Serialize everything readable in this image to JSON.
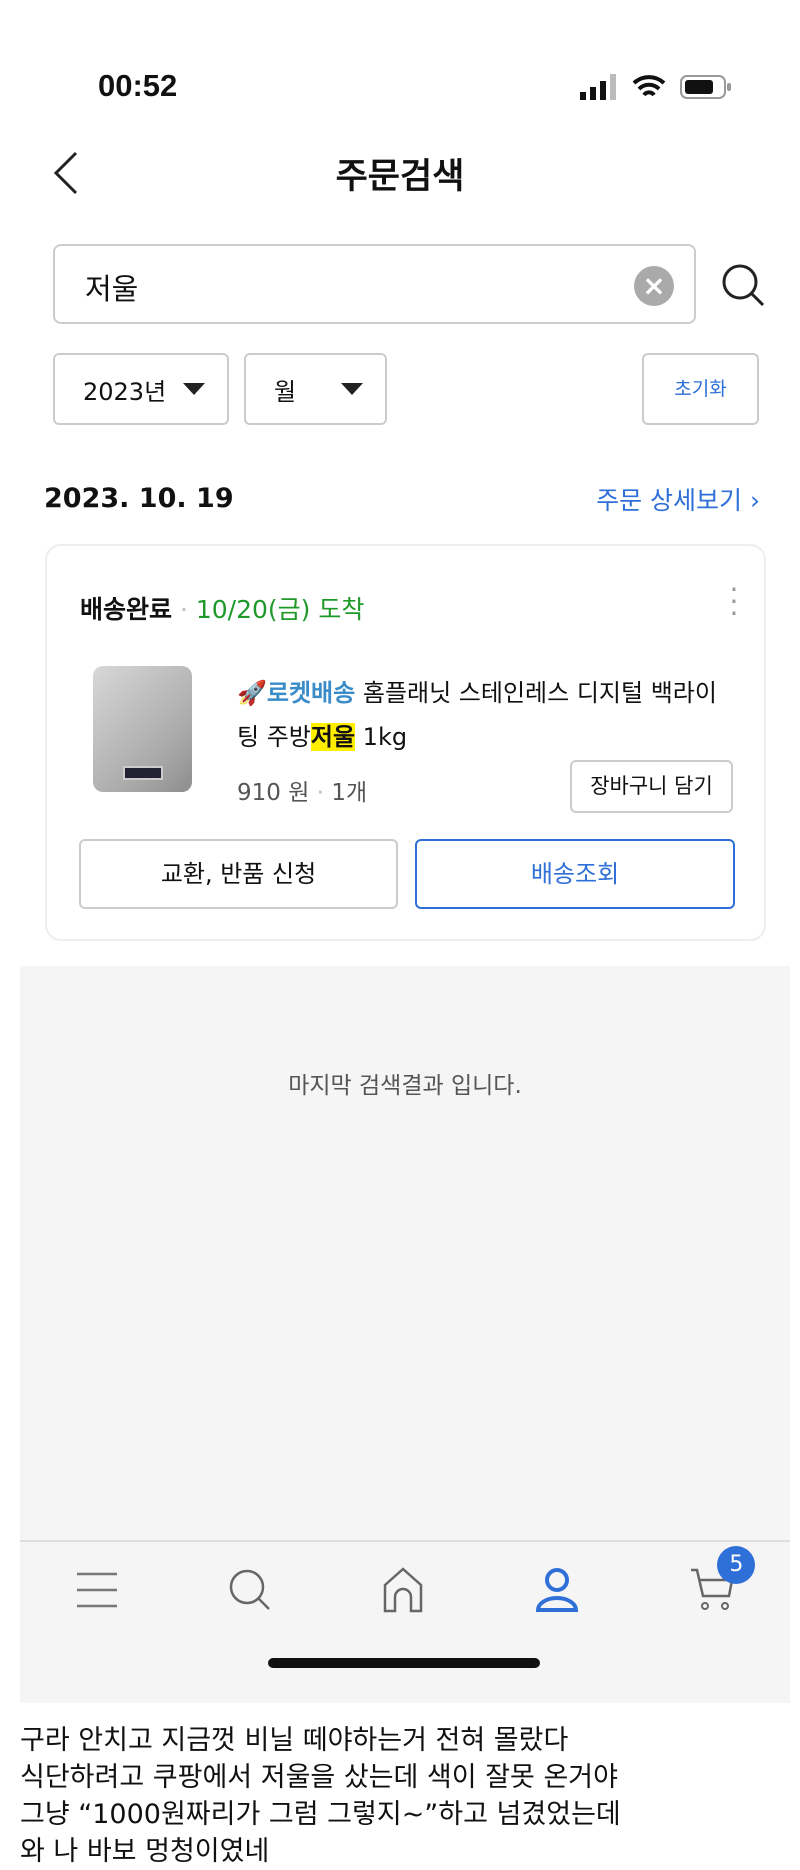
{
  "status": {
    "time": "00:52"
  },
  "header": {
    "title": "주문검색"
  },
  "search": {
    "value": "저울"
  },
  "filters": {
    "year": "2023년",
    "month": "월",
    "reset": "초기화"
  },
  "order": {
    "date": "2023. 10. 19",
    "detail_link": "주문 상세보기",
    "status": "배송완료",
    "arrival": "10/20(금) 도착",
    "rocket": "로켓배송",
    "title_pre": "홈플래닛 스테인레스 디지털 백라이팅 주방",
    "title_hl": "저울",
    "title_post": " 1kg",
    "price": "910 원",
    "qty": "1개",
    "cart_button": "장바구니 담기",
    "exchange_button": "교환, 반품 신청",
    "track_button": "배송조회"
  },
  "end_message": "마지막 검색결과 입니다.",
  "nav": {
    "cart_badge": "5",
    "active_color": "#2f6fd8"
  },
  "post_lines": [
    "구라 안치고 지금껏 비닐 떼야하는거 전혀 몰랐다",
    "식단하려고 쿠팡에서 저울을 샀는데 색이 잘못 온거야",
    "그냥 “1000원짜리가 그럼 그렇지~”하고 넘겼었는데",
    "와 나 바보 멍청이였네"
  ]
}
